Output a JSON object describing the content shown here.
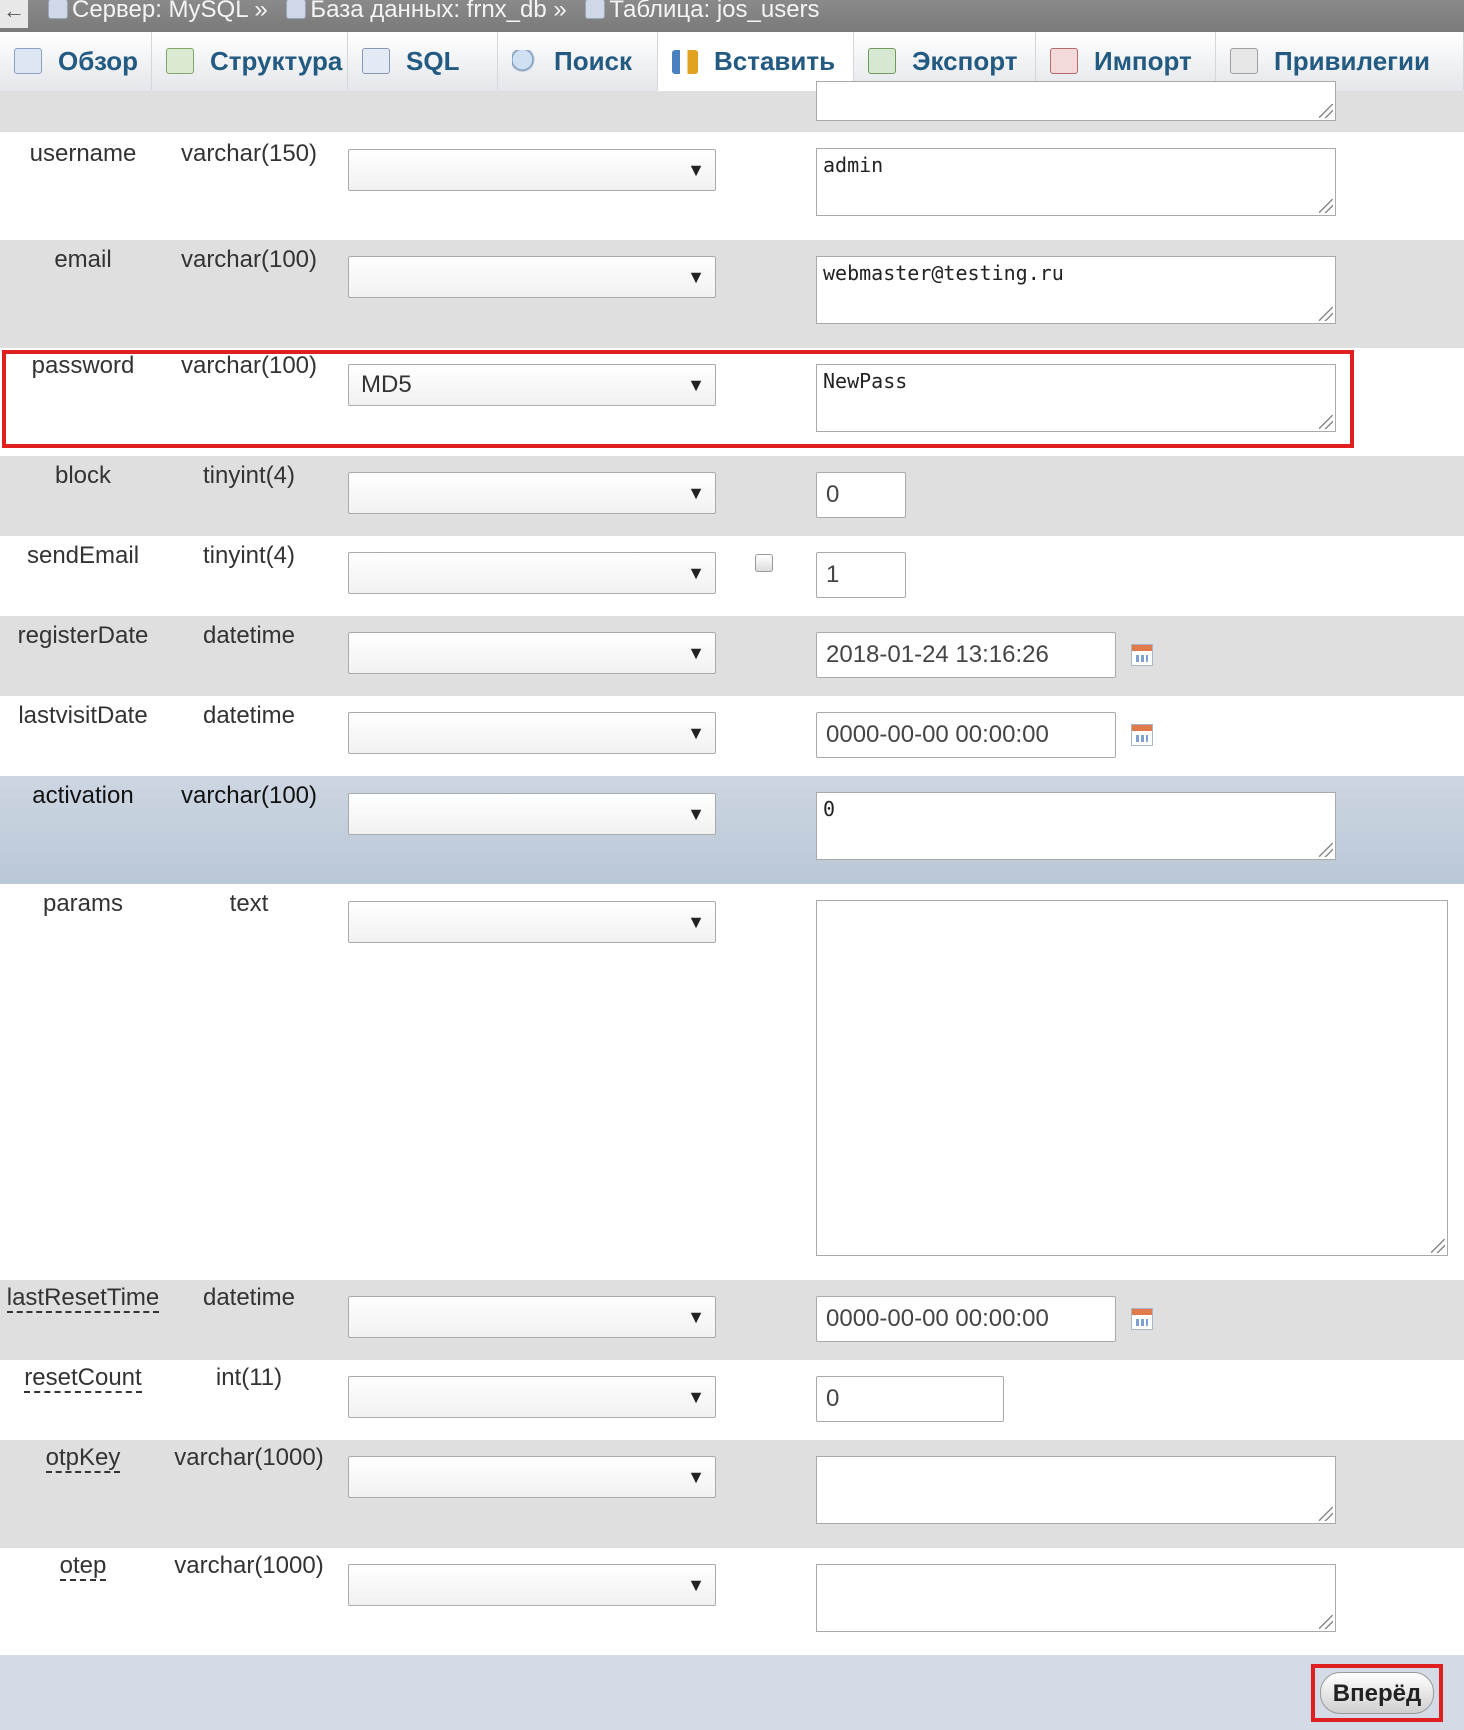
{
  "breadcrumb": {
    "server": "Сервер: MySQL »",
    "database": "База данных: frnx_db »",
    "table": "Таблица: jos_users"
  },
  "tabs": [
    {
      "label": "Обзор",
      "icon": "browse-icon"
    },
    {
      "label": "Структура",
      "icon": "structure-icon"
    },
    {
      "label": "SQL",
      "icon": "sql-icon"
    },
    {
      "label": "Поиск",
      "icon": "search-icon"
    },
    {
      "label": "Вставить",
      "icon": "insert-icon",
      "active": true
    },
    {
      "label": "Экспорт",
      "icon": "export-icon"
    },
    {
      "label": "Импорт",
      "icon": "import-icon"
    },
    {
      "label": "Привилегии",
      "icon": "privileges-icon"
    }
  ],
  "fields": [
    {
      "name": "username",
      "type": "varchar(150)",
      "function": "",
      "value": "admin"
    },
    {
      "name": "email",
      "type": "varchar(100)",
      "function": "",
      "value": "webmaster@testing.ru"
    },
    {
      "name": "password",
      "type": "varchar(100)",
      "function": "MD5",
      "value": "NewPass"
    },
    {
      "name": "block",
      "type": "tinyint(4)",
      "function": "",
      "value": "0"
    },
    {
      "name": "sendEmail",
      "type": "tinyint(4)",
      "function": "",
      "value": "1"
    },
    {
      "name": "registerDate",
      "type": "datetime",
      "function": "",
      "value": "2018-01-24 13:16:26"
    },
    {
      "name": "lastvisitDate",
      "type": "datetime",
      "function": "",
      "value": "0000-00-00 00:00:00"
    },
    {
      "name": "activation",
      "type": "varchar(100)",
      "function": "",
      "value": "0"
    },
    {
      "name": "params",
      "type": "text",
      "function": "",
      "value": ""
    },
    {
      "name": "lastResetTime",
      "type": "datetime",
      "function": "",
      "value": "0000-00-00 00:00:00"
    },
    {
      "name": "resetCount",
      "type": "int(11)",
      "function": "",
      "value": "0"
    },
    {
      "name": "otpKey",
      "type": "varchar(1000)",
      "function": "",
      "value": ""
    },
    {
      "name": "otep",
      "type": "varchar(1000)",
      "function": "",
      "value": ""
    }
  ],
  "footer": {
    "go_label": "Вперёд"
  },
  "colors": {
    "highlight": "#e02020",
    "tab_text": "#235a81"
  }
}
